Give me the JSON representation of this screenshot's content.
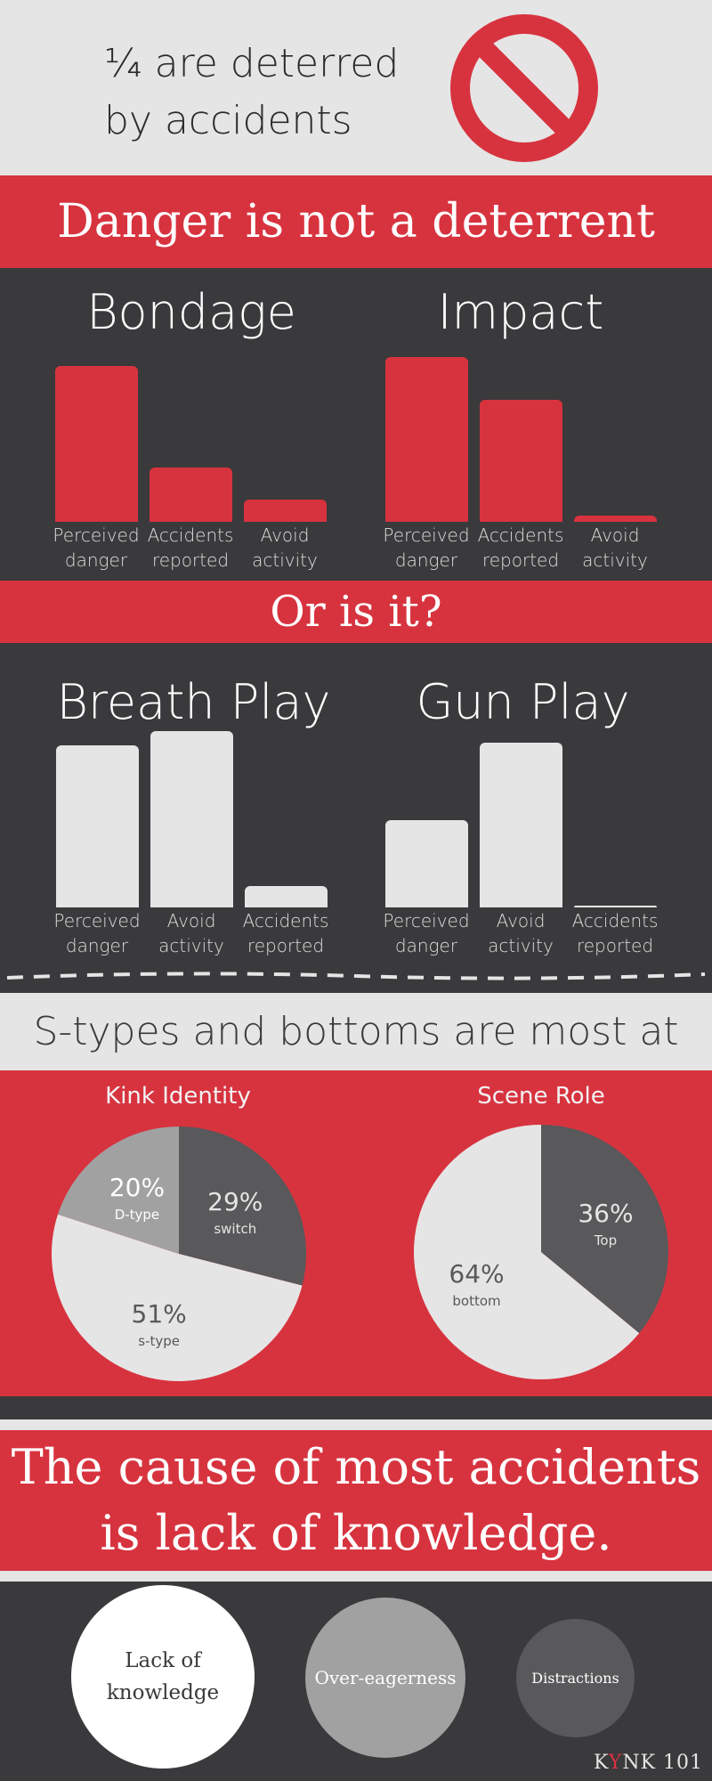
{
  "header": {
    "line1": "¼ are deterred",
    "line2": "by accidents"
  },
  "banner1": "Danger is not a deterrent",
  "banner2": "Or is it?",
  "banner3_line1": "The cause of most accidents",
  "banner3_line2": "is lack of knowledge.",
  "risk_heading": "S-types and bottoms are most at risk",
  "colors": {
    "red": "#d7333f",
    "dark": "#3a393b",
    "light": "#e6e5e5",
    "pie_dark": "#59585a",
    "pie_mid": "#a2a1a2"
  },
  "chart_data": [
    {
      "type": "bar",
      "title": "Bondage",
      "categories": [
        "Perceived|danger",
        "Accidents|reported",
        "Avoid|activity"
      ],
      "values": [
        100,
        35,
        14
      ],
      "ylim": [
        0,
        105
      ],
      "color": "#d7333f"
    },
    {
      "type": "bar",
      "title": "Impact",
      "categories": [
        "Perceived|danger",
        "Accidents|reported",
        "Avoid|activity"
      ],
      "values": [
        100,
        74,
        4
      ],
      "ylim": [
        0,
        105
      ],
      "color": "#d7333f"
    },
    {
      "type": "bar",
      "title": "Breath Play",
      "categories": [
        "Perceived|danger",
        "Avoid|activity",
        "Accidents|reported"
      ],
      "values": [
        92,
        100,
        12
      ],
      "ylim": [
        0,
        105
      ],
      "color": "#e6e5e5"
    },
    {
      "type": "bar",
      "title": "Gun Play",
      "categories": [
        "Perceived|danger",
        "Avoid|activity",
        "Accidents|reported"
      ],
      "values": [
        53,
        100,
        1
      ],
      "ylim": [
        0,
        105
      ],
      "color": "#e6e5e5"
    },
    {
      "type": "pie",
      "title": "Kink Identity",
      "slices": [
        {
          "label": "switch",
          "value": 29,
          "pct": "29%",
          "color": "#59585a",
          "text_color": "#e6e5e5"
        },
        {
          "label": "s-type",
          "value": 51,
          "pct": "51%",
          "color": "#e6e5e5",
          "text_color": "#59585a"
        },
        {
          "label": "D-type",
          "value": 20,
          "pct": "20%",
          "color": "#a2a1a2",
          "text_color": "#ffffff"
        }
      ]
    },
    {
      "type": "pie",
      "title": "Scene Role",
      "slices": [
        {
          "label": "Top",
          "value": 36,
          "pct": "36%",
          "color": "#59585a",
          "text_color": "#e6e5e5"
        },
        {
          "label": "bottom",
          "value": 64,
          "pct": "64%",
          "color": "#e6e5e5",
          "text_color": "#59585a"
        }
      ]
    }
  ],
  "causes": [
    {
      "label": "Lack of knowledge",
      "line1": "Lack of",
      "line2": "knowledge"
    },
    {
      "label": "Over-eagerness"
    },
    {
      "label": "Distractions"
    }
  ],
  "logo": {
    "k": "K",
    "y": "Y",
    "rest": "NK 101"
  }
}
